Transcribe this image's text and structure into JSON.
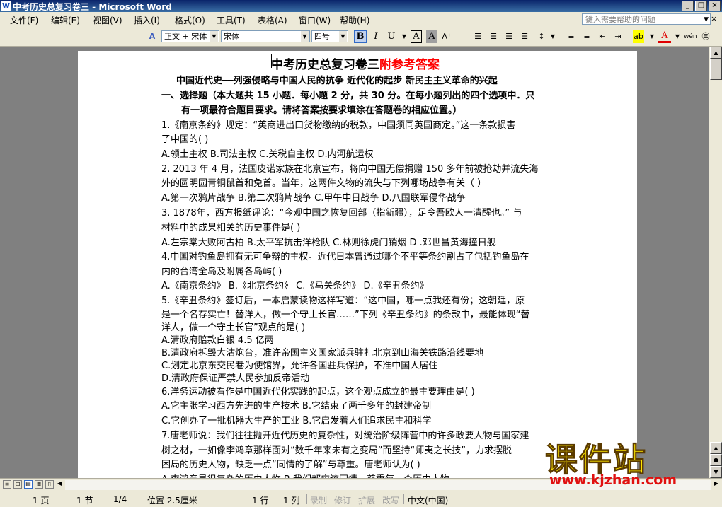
{
  "window": {
    "title": "中考历史总复习卷三 - Microsoft Word",
    "controls": [
      "_",
      "□",
      "×"
    ]
  },
  "menu": {
    "items": [
      "文件(F)",
      "编辑(E)",
      "视图(V)",
      "插入(I)",
      "格式(O)",
      "工具(T)",
      "表格(A)",
      "窗口(W)",
      "帮助(H)"
    ],
    "help_placeholder": "键入需要帮助的问题",
    "close": "×"
  },
  "toolbar": {
    "style": "正文 + 宋体",
    "font": "宋体",
    "size": "四号",
    "bold": "B",
    "italic": "I",
    "underline": "U",
    "char_border": "A",
    "char_shading": "A",
    "phonetic": "wén",
    "style_icon": "A"
  },
  "document": {
    "title": "中考历史总复习卷三",
    "title_suffix": "附参考答案",
    "subtitle": "中国近代史──列强侵略与中国人民的抗争 近代化的起步 新民主主义革命的兴起",
    "section1_line1": "一、选择题（本大题共 15 小题．每小题 2 分，共 30 分。在每小题列出的四个选项中．只",
    "section1_line2": "有一项最符合题目要求。请将答案按要求填涂在答题卷的相应位置。）",
    "lines": [
      "1.《南京条约》规定：“英商进出口货物缴纳的税款，中国须同英国商定。”这一条款损害",
      "了中国的(        )",
      "A.领土主权        B.司法主权        C.关税自主权        D.内河航运权",
      "2. 2013 年 4 月，法国皮诺家族在北京宣布，将向中国无偿捐赠 150 多年前被抢劫并流失海",
      "外的圆明园青铜鼠首和兔首。当年，这两件文物的流失与下列哪场战争有关（        ）",
      "A.第一次鸦片战争        B.第二次鸦片战争    C.甲午中日战争        D.八国联军侵华战争",
      "3. 1878年，西方报纸评论：“今观中国之恢复回部（指新疆），足令吾欧人一清醒也。” 与",
      "材料中的成果相关的历史事件是(        )",
      "A.左宗棠大败阿古柏    B.太平军抗击洋枪队  C.林则徐虎门销烟   D .邓世昌黄海撞日舰",
      "4.中国对钓鱼岛拥有无可争辩的主权。近代日本曾通过哪个不平等条约割占了包括钓鱼岛在",
      "内的台湾全岛及附属各岛屿(        )",
      "A.《南京条约》    B.《北京条约》     C.《马关条约》  D.《辛丑条约》",
      "5.《辛丑条约》签订后，一本启蒙读物这样写道：“这中国，哪一点我还有份；这朝廷，原",
      "是一个名存实亡！替洋人，做一个守土长官……”下列《辛丑条约》的条款中，最能体现“替",
      "洋人，做一个守土长官”观点的是(        )",
      "A.清政府赔款白银 4.5 亿两",
      "B.清政府拆毁大沽炮台，准许帝国主义国家派兵驻扎北京到山海关铁路沿线要地",
      "C.划定北京东交民巷为使馆界，允许各国驻兵保护，不准中国人居住",
      "D.清政府保证严禁人民参加反帝活动",
      "6.洋务运动被看作是中国近代化实践的起点，这个观点成立的最主要理由是(        )",
      "A.它主张学习西方先进的生产技术                B.它结束了两千多年的封建帝制",
      "C.它创办了一批机器大生产的工业                B.它启发着人们追求民主和科学",
      "7.唐老师说：我们往往抛开近代历史的复杂性，对统治阶级阵营中的许多政要人物与国家建",
      "树之材，一如像李鸿章那样面对“数千年来未有之变局”而坚持“师夷之长技”，力求摆脱",
      "困局的历史人物，缺乏一点“同情的了解”与尊重。唐老师认为(        )",
      "A.李鸿章是很复杂的历史人物        B.我们都应该同情、尊重每一个历史人物"
    ]
  },
  "statusbar": {
    "page": "1 页",
    "section": "1 节",
    "pages": "1/4",
    "position": "位置 2.5厘米",
    "line": "1 行",
    "col": "1 列",
    "rec": "录制",
    "trk": "修订",
    "ext": "扩展",
    "ovr": "改写",
    "lang": "中文(中国)"
  },
  "watermark": {
    "text": "课件站",
    "url": "www.kjzhan.com"
  }
}
